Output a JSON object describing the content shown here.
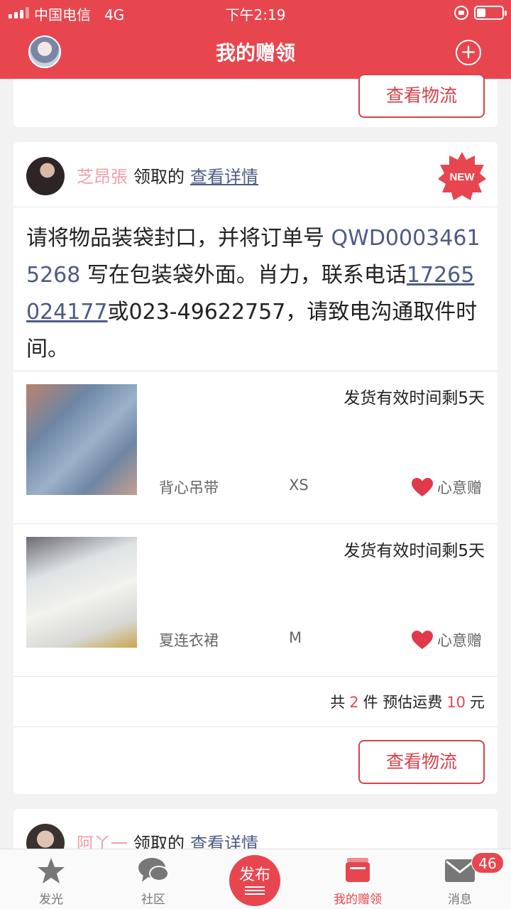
{
  "status_bar": {
    "carrier": "中国电信",
    "network": "4G",
    "time": "下午2:19"
  },
  "header": {
    "title": "我的赠领"
  },
  "cards": [
    {
      "logistics_button": "查看物流"
    },
    {
      "user": {
        "name": "芝昂張",
        "claimed": "领取的",
        "details_link": "查看详情"
      },
      "badge": "NEW",
      "message": {
        "prefix": "请将物品装袋封口，并将订单号 ",
        "order_no": "QWD00034615268",
        "middle": " 写在包装袋外面。肖力，联系电话",
        "phone": "17265024177",
        "suffix": "或023-49622757，请致电沟通取件时间。"
      },
      "items": [
        {
          "deadline": "发货有效时间剩5天",
          "name": "背心吊带",
          "size": "XS",
          "gift_type": "心意赠"
        },
        {
          "deadline": "发货有效时间剩5天",
          "name": "夏连衣裙",
          "size": "M",
          "gift_type": "心意赠"
        }
      ],
      "summary": {
        "total_prefix": "共",
        "count": "2",
        "count_unit": "件",
        "shipping_label": "预估运费",
        "shipping": "10",
        "currency": "元"
      },
      "logistics_button": "查看物流"
    },
    {
      "user": {
        "name": "阿丫一",
        "claimed": "领取的",
        "details_link": "查看详情"
      }
    }
  ],
  "tabbar": {
    "tabs": [
      {
        "label": "发光",
        "icon": "star-icon"
      },
      {
        "label": "社区",
        "icon": "chat-bubble-icon"
      },
      {
        "label": "发布",
        "icon": "publish-icon"
      },
      {
        "label": "我的赠领",
        "icon": "my-gifts-icon"
      },
      {
        "label": "消息",
        "icon": "mail-icon"
      }
    ],
    "message_badge": "46"
  },
  "colors": {
    "brand": "#e8464f",
    "link": "#4d5b86",
    "username": "#f0a0a8"
  }
}
